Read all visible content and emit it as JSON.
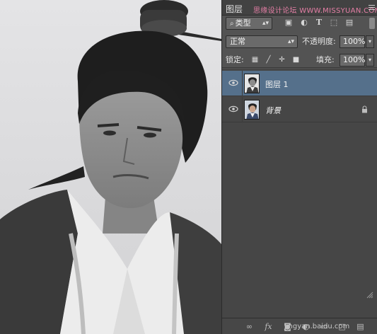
{
  "panel": {
    "tab_label": "图层",
    "watermark": "思缘设计论坛 WWW.MISSYUAN.COM",
    "menu_icon": "panel-menu-icon"
  },
  "filter": {
    "selected": "类型",
    "icons": [
      "image-filter-icon",
      "adjustment-filter-icon",
      "type-filter-icon",
      "shape-filter-icon",
      "smart-object-filter-icon"
    ]
  },
  "blend": {
    "mode": "正常",
    "opacity_label": "不透明度:",
    "opacity_value": "100%"
  },
  "lock": {
    "label": "锁定:",
    "icons": [
      "lock-transparent-icon",
      "lock-image-icon",
      "lock-position-icon",
      "lock-all-icon"
    ],
    "fill_label": "填充:",
    "fill_value": "100%"
  },
  "layers": [
    {
      "name": "图层 1",
      "selected": true,
      "visible": true,
      "locked": false
    },
    {
      "name": "背景",
      "selected": false,
      "visible": true,
      "locked": true
    }
  ],
  "footer": {
    "watermark": "jingyan.baidu.com",
    "buttons": [
      "link-layers-icon",
      "fx-icon",
      "add-mask-icon",
      "adjustment-layer-icon",
      "new-group-icon",
      "new-layer-icon",
      "delete-layer-icon"
    ]
  },
  "colors": {
    "panel_bg": "#535353",
    "selected_layer": "#55708b",
    "watermark_pink": "#e57fa6"
  }
}
